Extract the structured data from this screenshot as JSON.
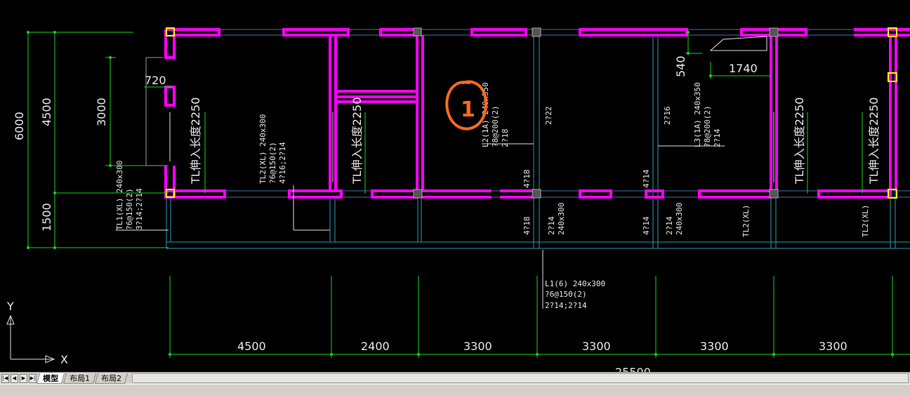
{
  "drawing": {
    "dimensions_left": {
      "total": "6000",
      "upper": "4500",
      "lower": "1500",
      "inner": "3000",
      "offset": "720"
    },
    "dimensions_top_right": {
      "a": "540",
      "b": "1740"
    },
    "dimensions_bottom": [
      "4500",
      "2400",
      "3300",
      "3300",
      "3300",
      "3300"
    ],
    "dimension_bottom_total": "25500",
    "stair_labels": [
      "TL伸入长度2250",
      "TL伸入长度2250",
      "TL伸入长度2250",
      "TL伸入长度2250"
    ],
    "beam_tl1": [
      "TL1(XL) 240x300",
      "?6@150(2)",
      "3?14;2?14"
    ],
    "beam_tl2": [
      "TL2(XL) 240x300",
      "?6@150(2)",
      "4?16;2?14"
    ],
    "beam_l2": [
      "L2(1A) 240x350",
      "?8@200(2)",
      "2?18"
    ],
    "beam_l3": [
      "L3(1A) 240x350",
      "?8@200(2)",
      "2?14"
    ],
    "beam_l1": [
      "L1(6) 240x300",
      "?6@150(2)",
      "2?14;2?14"
    ],
    "rebar_labels": {
      "r1": "2?22",
      "r2": "2?16",
      "r3": "4?18",
      "r4": "4?14",
      "r5": "4?18",
      "r6": "4?14"
    },
    "beam_small_a": [
      "2?14",
      "240x300"
    ],
    "beam_small_b": [
      "2?14",
      "240x300"
    ],
    "tl2xl_labels": [
      "TL2(XL)",
      "TL2(XL)"
    ],
    "annotation_circle_text": "1",
    "ucs": {
      "y": "Y",
      "x": "X"
    }
  },
  "tabs": [
    {
      "label": "模型",
      "active": true
    },
    {
      "label": "布局1",
      "active": false
    },
    {
      "label": "布局2",
      "active": false
    }
  ],
  "nav_buttons": [
    "|◀",
    "◀",
    "▶",
    "▶|"
  ],
  "colors": {
    "background": "#000000",
    "wall": "#ff00ff",
    "dimension": "#19d219",
    "annotation": "#ff6a1a",
    "column_marker": "#ffff00"
  }
}
